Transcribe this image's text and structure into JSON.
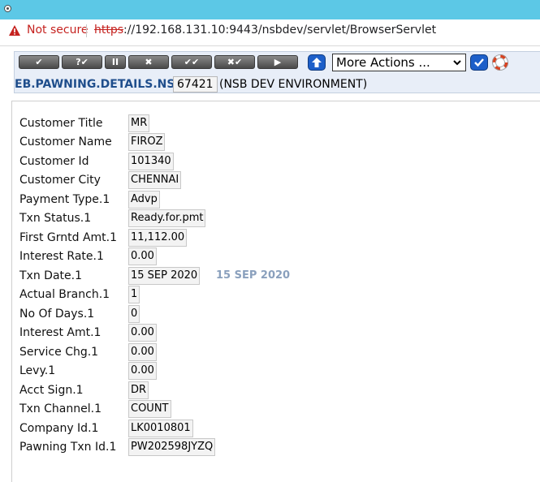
{
  "browser": {
    "security_label": "Not secure",
    "url_scheme": "https",
    "url_rest": "://192.168.131.10:9443/nsbdev/servlet/BrowserServlet"
  },
  "toolbar": {
    "buttons": [
      {
        "name": "commit-button",
        "glyph": "✔"
      },
      {
        "name": "validate-button",
        "glyph": "?✔"
      },
      {
        "name": "hold-button",
        "glyph": "II"
      },
      {
        "name": "delete-button",
        "glyph": "✖"
      },
      {
        "name": "authorise-button",
        "glyph": "✔✔"
      },
      {
        "name": "reverse-button",
        "glyph": "✖✔"
      },
      {
        "name": "next-button",
        "glyph": "▶"
      }
    ],
    "more_actions_label": "More Actions ...",
    "app_id": "EB.PAWNING.DETAILS.NSB",
    "record_id": "67421",
    "environment": "(NSB DEV ENVIRONMENT)"
  },
  "fields": [
    {
      "label": "Customer Title",
      "value": "MR"
    },
    {
      "label": "Customer Name",
      "value": "FIROZ"
    },
    {
      "label": "Customer Id",
      "value": "101340"
    },
    {
      "label": "Customer City",
      "value": "CHENNAI"
    },
    {
      "label": "Payment Type.1",
      "value": "Advp"
    },
    {
      "label": "Txn Status.1",
      "value": "Ready.for.pmt"
    },
    {
      "label": "First Grntd Amt.1",
      "value": "11,112.00"
    },
    {
      "label": "Interest Rate.1",
      "value": "0.00"
    },
    {
      "label": "Txn Date.1",
      "value": "15 SEP 2020",
      "echo": "15 SEP 2020"
    },
    {
      "label": "Actual Branch.1",
      "value": "1"
    },
    {
      "label": "No Of Days.1",
      "value": "0"
    },
    {
      "label": "Interest Amt.1",
      "value": "0.00"
    },
    {
      "label": "Service Chg.1",
      "value": "0.00"
    },
    {
      "label": "Levy.1",
      "value": "0.00"
    },
    {
      "label": "Acct Sign.1",
      "value": "DR"
    },
    {
      "label": "Txn Channel.1",
      "value": "COUNT"
    },
    {
      "label": "Company Id.1",
      "value": "LK0010801"
    },
    {
      "label": "Pawning Txn Id.1",
      "value": "PW202598JYZQ"
    }
  ],
  "colors": {
    "titlebar": "#5cc8e6",
    "app_id": "#1f4e8c",
    "date_echo": "#8aa0bd",
    "warning": "#c5221f"
  },
  "icons": [
    "app-icon",
    "warning-icon",
    "up-arrow-icon",
    "checkmark-icon",
    "lifebuoy-icon",
    "chevron-down-icon"
  ]
}
